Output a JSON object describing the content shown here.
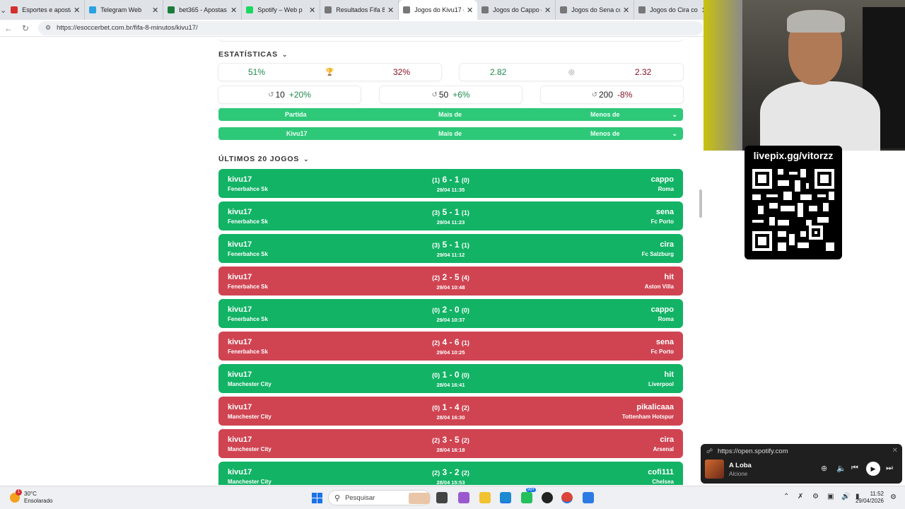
{
  "browser": {
    "tabs": [
      {
        "label": "Esportes e apostas a",
        "color": "#d32f2f"
      },
      {
        "label": "Telegram Web",
        "color": "#2aa3e0"
      },
      {
        "label": "bet365 - Apostas Esp",
        "color": "#1b7b3c"
      },
      {
        "label": "Spotify – Web p",
        "color": "#1ed760"
      },
      {
        "label": "Resultados Fifa 8 mi",
        "color": "#777777"
      },
      {
        "label": "Jogos do Kivu17 co",
        "color": "#777777",
        "active": true
      },
      {
        "label": "Jogos do Cappo co",
        "color": "#777777"
      },
      {
        "label": "Jogos do Sena com",
        "color": "#777777"
      },
      {
        "label": "Jogos do Cira co",
        "color": "#777777"
      }
    ],
    "url": "https://esoccerbet.com.br/fifa-8-minutos/kivu17/"
  },
  "stats": {
    "title": "ESTATÍSTICAS",
    "win_pct": "51%",
    "loss_pct": "32%",
    "goals_for": "2.82",
    "goals_against": "2.32",
    "recent": [
      {
        "count": "10",
        "delta": "+20%"
      },
      {
        "count": "50",
        "delta": "+6%"
      },
      {
        "count": "200",
        "delta": "-8%"
      }
    ]
  },
  "filters": [
    {
      "label": "Partida",
      "more": "Mais de",
      "less": "Menos de"
    },
    {
      "label": "Kivu17",
      "more": "Mais de",
      "less": "Menos de"
    }
  ],
  "games_section": {
    "title": "ÚLTIMOS 20 JOGOS"
  },
  "games": [
    {
      "player": "kivu17",
      "team": "Fenerbahce Sk",
      "ht_home": "(1)",
      "score": "6 - 1",
      "ht_away": "(0)",
      "date": "29/04 11:35",
      "opp": "cappo",
      "opp_team": "Roma",
      "result": "win"
    },
    {
      "player": "kivu17",
      "team": "Fenerbahce Sk",
      "ht_home": "(3)",
      "score": "5 - 1",
      "ht_away": "(1)",
      "date": "29/04 11:23",
      "opp": "sena",
      "opp_team": "Fc Porto",
      "result": "win"
    },
    {
      "player": "kivu17",
      "team": "Fenerbahce Sk",
      "ht_home": "(3)",
      "score": "5 - 1",
      "ht_away": "(1)",
      "date": "29/04 11:12",
      "opp": "cira",
      "opp_team": "Fc Salzburg",
      "result": "win"
    },
    {
      "player": "kivu17",
      "team": "Fenerbahce Sk",
      "ht_home": "(2)",
      "score": "2 - 5",
      "ht_away": "(4)",
      "date": "29/04 10:48",
      "opp": "hit",
      "opp_team": "Aston Villa",
      "result": "loss"
    },
    {
      "player": "kivu17",
      "team": "Fenerbahce Sk",
      "ht_home": "(0)",
      "score": "2 - 0",
      "ht_away": "(0)",
      "date": "29/04 10:37",
      "opp": "cappo",
      "opp_team": "Roma",
      "result": "win"
    },
    {
      "player": "kivu17",
      "team": "Fenerbahce Sk",
      "ht_home": "(2)",
      "score": "4 - 6",
      "ht_away": "(1)",
      "date": "29/04 10:25",
      "opp": "sena",
      "opp_team": "Fc Porto",
      "result": "loss"
    },
    {
      "player": "kivu17",
      "team": "Manchester City",
      "ht_home": "(0)",
      "score": "1 - 0",
      "ht_away": "(0)",
      "date": "28/04 16:41",
      "opp": "hit",
      "opp_team": "Liverpool",
      "result": "win"
    },
    {
      "player": "kivu17",
      "team": "Manchester City",
      "ht_home": "(0)",
      "score": "1 - 4",
      "ht_away": "(2)",
      "date": "28/04 16:30",
      "opp": "pikalicaaa",
      "opp_team": "Tottenham Hotspur",
      "result": "loss"
    },
    {
      "player": "kivu17",
      "team": "Manchester City",
      "ht_home": "(2)",
      "score": "3 - 5",
      "ht_away": "(2)",
      "date": "28/04 16:18",
      "opp": "cira",
      "opp_team": "Arsenal",
      "result": "loss"
    },
    {
      "player": "kivu17",
      "team": "Manchester City",
      "ht_home": "(2)",
      "score": "3 - 2",
      "ht_away": "(2)",
      "date": "28/04 15:53",
      "opp": "cofi111",
      "opp_team": "Chelsea",
      "result": "win"
    }
  ],
  "overlay": {
    "qr_label": "livepix.gg/vitorzz"
  },
  "spotify": {
    "url": "https://open.spotify.com",
    "track": "A Loba",
    "artist": "Alcione"
  },
  "taskbar": {
    "temp": "30°C",
    "weather": "Ensolarado",
    "weather_badge": "1",
    "search_placeholder": "Pesquisar",
    "badge": "99+",
    "time": "11:52",
    "date": "29/04/2026"
  }
}
